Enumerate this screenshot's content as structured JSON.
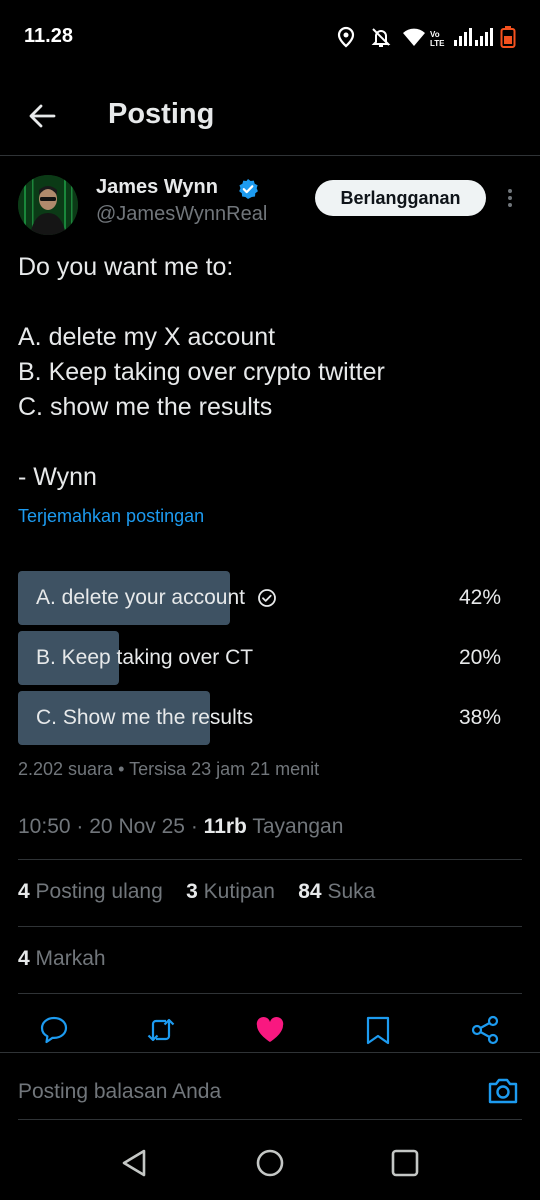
{
  "status_bar": {
    "time": "11.28",
    "icons": [
      "location-icon",
      "alarm-off-icon",
      "wifi-icon",
      "volte-icon",
      "signal-icon",
      "signal-icon",
      "battery-icon"
    ],
    "volte_text": "Vo LTE"
  },
  "header": {
    "title": "Posting",
    "back_icon": "arrow-left-icon"
  },
  "author": {
    "name": "James Wynn",
    "handle": "@JamesWynnReal",
    "verified": true,
    "verified_color": "#1d9bf0",
    "subscribe_label": "Berlangganan"
  },
  "tweet": {
    "lines": [
      "Do you want me to:",
      "",
      "A. delete my X account",
      "B. Keep taking over crypto twitter",
      "C. show me the results",
      "",
      "- Wynn"
    ],
    "translate_label": "Terjemahkan postingan"
  },
  "poll": {
    "options": [
      {
        "label": "A. delete your account",
        "percent_label": "42%",
        "percent": 42,
        "selected": true
      },
      {
        "label": "B. Keep taking over CT",
        "percent_label": "20%",
        "percent": 20,
        "selected": false
      },
      {
        "label": "C. Show me the results",
        "percent_label": "38%",
        "percent": 38,
        "selected": false
      }
    ],
    "votes": "2.202 suara",
    "separator": "•",
    "time_left": "Tersisa 23 jam 21 menit"
  },
  "meta": {
    "time": "10:50",
    "date": "20 Nov 25",
    "separator": "·",
    "views_count": "11rb",
    "views_label": "Tayangan"
  },
  "stats": {
    "reposts_count": "4",
    "reposts_label": "Posting ulang",
    "quotes_count": "3",
    "quotes_label": "Kutipan",
    "likes_count": "84",
    "likes_label": "Suka",
    "bookmarks_count": "4",
    "bookmarks_label": "Markah"
  },
  "actions": {
    "icons": [
      "reply-icon",
      "repost-icon",
      "like-icon",
      "bookmark-icon",
      "share-icon"
    ],
    "like_color": "#f91880",
    "icon_color": "#1d9bf0"
  },
  "reply": {
    "placeholder": "Posting balasan Anda",
    "camera_icon": "camera-icon"
  },
  "nav": {
    "icons": [
      "back-triangle-icon",
      "home-circle-icon",
      "recents-square-icon"
    ]
  },
  "colors": {
    "accent": "#1d9bf0",
    "poll_bar": "#3e5263",
    "muted": "#71767b"
  }
}
